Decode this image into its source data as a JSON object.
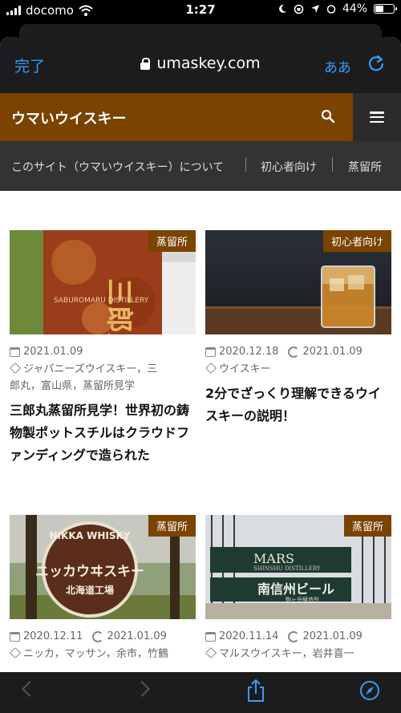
{
  "status": {
    "carrier": "docomo",
    "time": "1:27",
    "battery": "44%",
    "battery_level": 0.44
  },
  "safari": {
    "done_label": "完了",
    "url": "umaskey.com",
    "text_size_label": "ああ"
  },
  "site": {
    "brand": "ウマいウイスキー",
    "nav": [
      "このサイト（ウマいウイスキー）について",
      "初心者向け",
      "蒸留所"
    ]
  },
  "cards": [
    {
      "category": "蒸留所",
      "date": "2021.01.09",
      "updated": "",
      "tags_line1": "ジャパニーズウイスキー，三",
      "tags_line2": "郎丸，富山県，蒸留所見学",
      "title": "三郎丸蒸留所見学！世界初の鋳物製ポットスチルはクラウドファンディングで造られた",
      "image_text": "三郎丸",
      "image_subtext": "SABUROMARU DISTILLERY"
    },
    {
      "category": "初心者向け",
      "date": "2020.12.18",
      "updated": "2021.01.09",
      "tags_line1": "ウイスキー",
      "tags_line2": "",
      "title": "2分でざっくり理解できるウイスキーの説明！"
    },
    {
      "category": "蒸留所",
      "date": "2020.12.11",
      "updated": "2021.01.09",
      "tags_line1": "ニッカ，マッサン，余市，竹鶴",
      "tags_line2": "",
      "title": "",
      "sign_top": "NIKKA WHISKY",
      "sign_main": "ニッカウヰスキー",
      "sign_sub": "北海道工場"
    },
    {
      "category": "蒸留所",
      "date": "2020.11.14",
      "updated": "2021.01.09",
      "tags_line1": "マルスウイスキー，岩井喜一",
      "tags_line2": "",
      "title": "",
      "sign_top": "MARS",
      "sign_top_sub": "SHINSHU DISTILLERY",
      "sign_main": "南信州ビール",
      "sign_sub": "駒ヶ岳醸造所"
    }
  ],
  "colors": {
    "brand": "#7a4300",
    "link": "#3a9bf6",
    "toolbar": "#1c1c1e"
  },
  "icons": {
    "search": "search-icon",
    "menu": "hamburger-menu-icon",
    "lock": "lock-icon",
    "reload": "reload-icon",
    "share": "share-icon",
    "compass": "compass-icon"
  }
}
